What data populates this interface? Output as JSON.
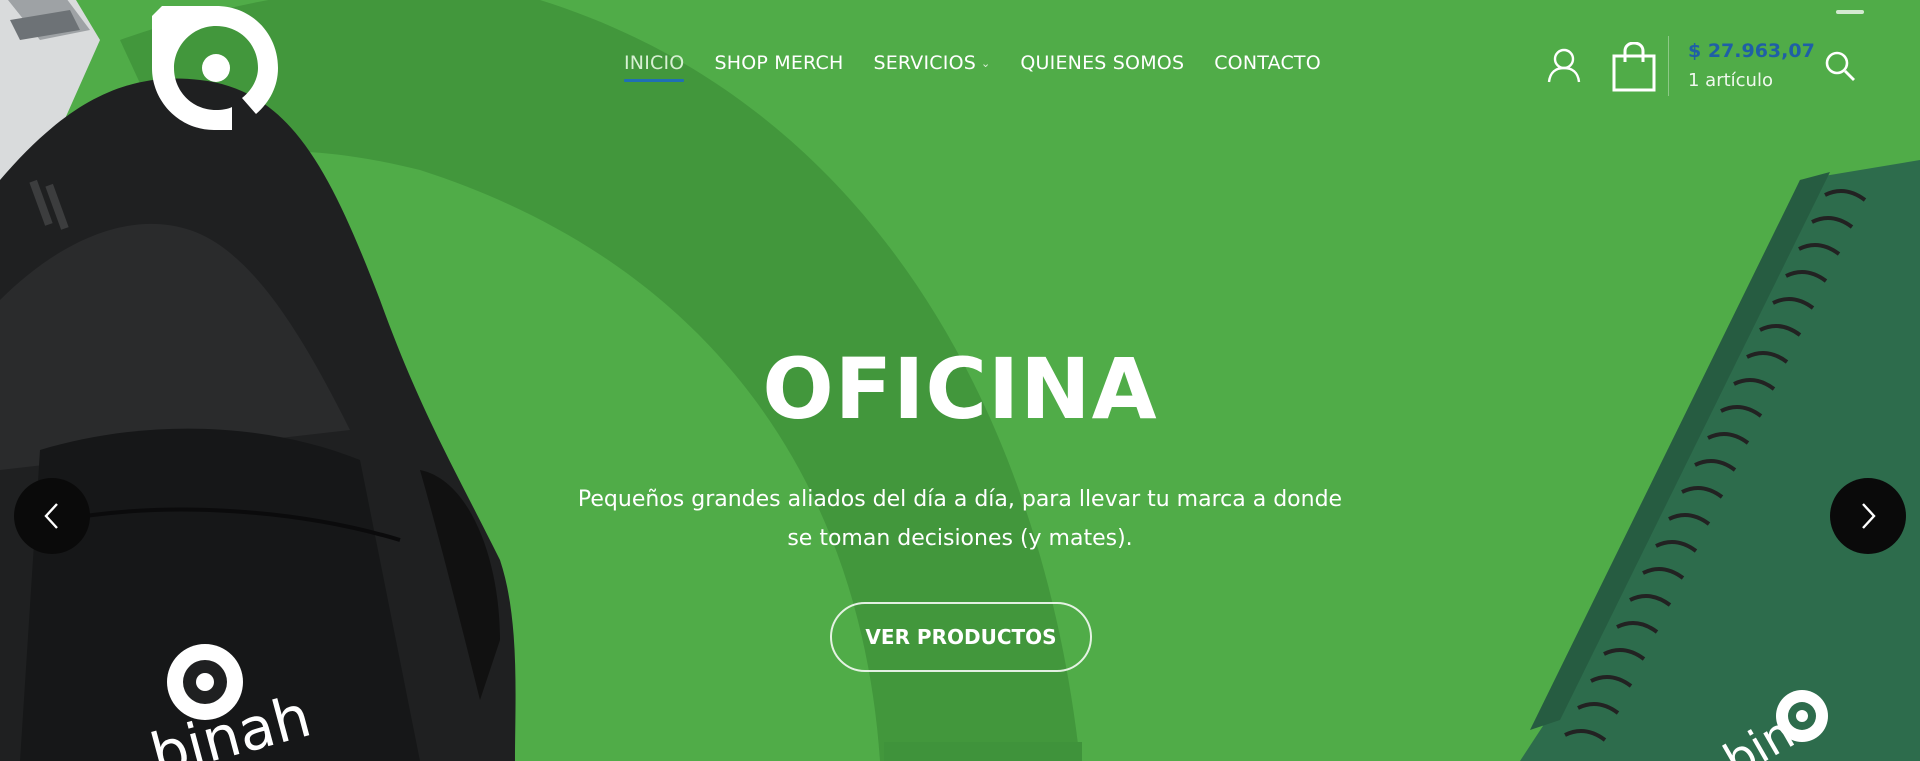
{
  "nav": {
    "items": [
      {
        "label": "INICIO",
        "active": true
      },
      {
        "label": "SHOP MERCH",
        "active": false
      },
      {
        "label": "SERVICIOS",
        "active": false,
        "has_dropdown": true
      },
      {
        "label": "QUIENES SOMOS",
        "active": false
      },
      {
        "label": "CONTACTO",
        "active": false
      }
    ]
  },
  "cart": {
    "total": "$ 27.963,07",
    "count": "1 artículo"
  },
  "hero": {
    "title": "OFICINA",
    "subtitle_line1": "Pequeños grandes aliados del día a día, para llevar tu marca a donde",
    "subtitle_line2": "se toman decisiones (y mates).",
    "button": "VER PRODUCTOS"
  },
  "icons": {
    "logo": "brand-logo",
    "account": "user-icon",
    "cart": "shopping-bag-icon",
    "search": "search-icon",
    "dropdown": "chevron-down-icon",
    "prev": "chevron-left-icon",
    "next": "chevron-right-icon"
  },
  "colors": {
    "background": "#50ac48",
    "arc": "#3f923b",
    "active_underline": "#1f6fb4",
    "cart_total": "#1f5fa6"
  }
}
